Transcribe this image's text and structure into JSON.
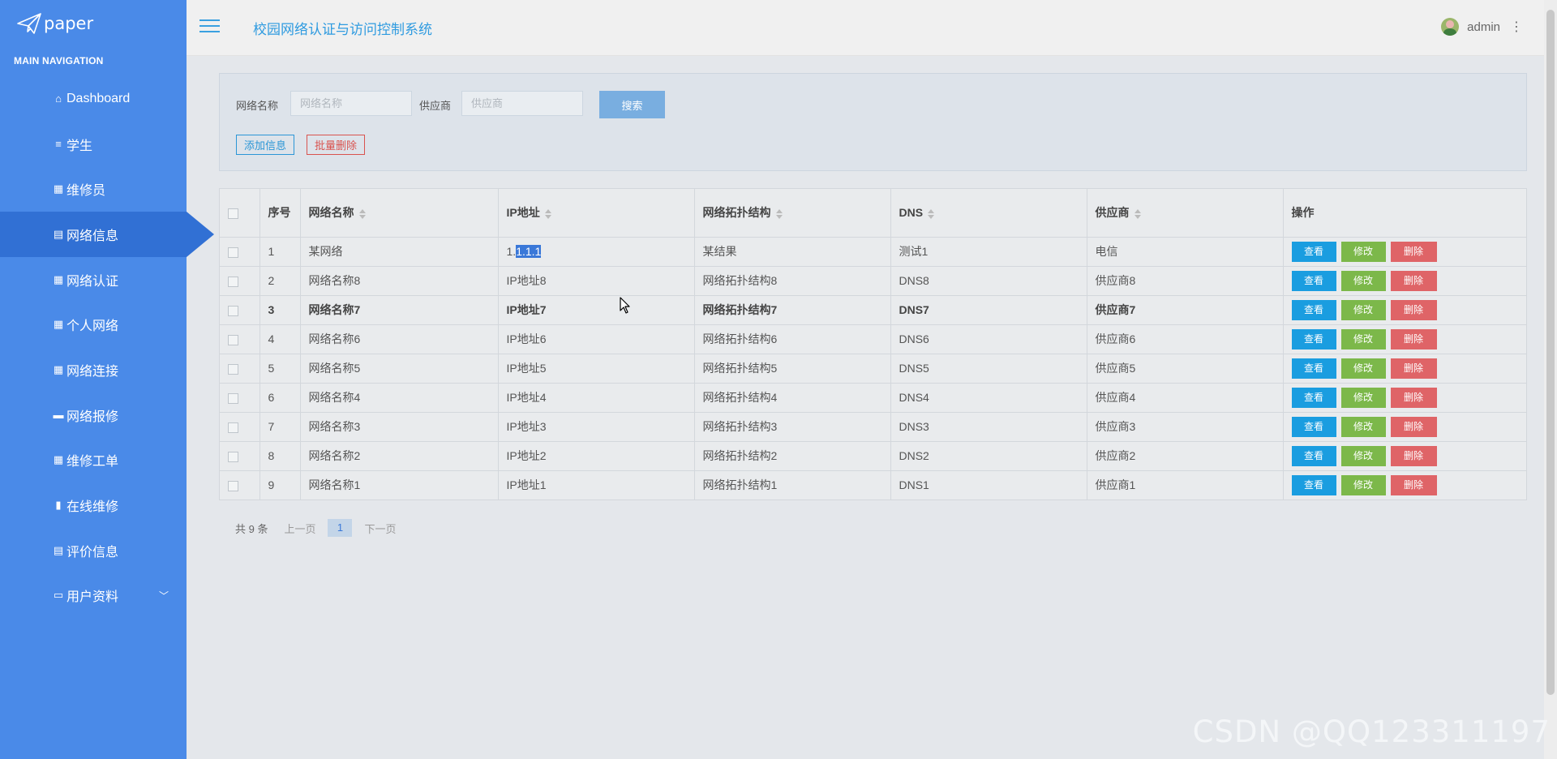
{
  "app": {
    "logo_text": "paper",
    "system_title": "校园网络认证与访问控制系统",
    "user_name": "admin"
  },
  "sidebar": {
    "header": "MAIN NAVIGATION",
    "items": [
      {
        "label": "Dashboard",
        "icon": "home-icon"
      },
      {
        "label": "学生",
        "icon": "list-icon"
      },
      {
        "label": "维修员",
        "icon": "grid-icon"
      },
      {
        "label": "网络信息",
        "icon": "clipboard-icon",
        "active": true
      },
      {
        "label": "网络认证",
        "icon": "grid-icon"
      },
      {
        "label": "个人网络",
        "icon": "grid-icon"
      },
      {
        "label": "网络连接",
        "icon": "grid-icon"
      },
      {
        "label": "网络报修",
        "icon": "briefcase-icon"
      },
      {
        "label": "维修工单",
        "icon": "grid-icon"
      },
      {
        "label": "在线维修",
        "icon": "book-icon"
      },
      {
        "label": "评价信息",
        "icon": "clipboard-icon"
      },
      {
        "label": "用户资料",
        "icon": "card-icon"
      }
    ]
  },
  "search": {
    "name_label": "网络名称",
    "name_placeholder": "网络名称",
    "vendor_label": "供应商",
    "vendor_placeholder": "供应商",
    "search_button": "搜索",
    "add_button": "添加信息",
    "batch_delete_button": "批量删除"
  },
  "table": {
    "headers": [
      "序号",
      "网络名称",
      "IP地址",
      "网络拓扑结构",
      "DNS",
      "供应商",
      "操作"
    ],
    "actions": {
      "view": "查看",
      "edit": "修改",
      "delete": "删除"
    },
    "rows": [
      {
        "no": "1",
        "name": "某网络",
        "ip_a": "1.",
        "ip_b": "1.1.1",
        "topo": "某结果",
        "dns": "测试1",
        "vendor": "电信"
      },
      {
        "no": "2",
        "name": "网络名称8",
        "ip_a": "IP地址8",
        "ip_b": "",
        "topo": "网络拓扑结构8",
        "dns": "DNS8",
        "vendor": "供应商8"
      },
      {
        "no": "3",
        "name": "网络名称7",
        "ip_a": "IP地址7",
        "ip_b": "",
        "topo": "网络拓扑结构7",
        "dns": "DNS7",
        "vendor": "供应商7",
        "bold": true
      },
      {
        "no": "4",
        "name": "网络名称6",
        "ip_a": "IP地址6",
        "ip_b": "",
        "topo": "网络拓扑结构6",
        "dns": "DNS6",
        "vendor": "供应商6"
      },
      {
        "no": "5",
        "name": "网络名称5",
        "ip_a": "IP地址5",
        "ip_b": "",
        "topo": "网络拓扑结构5",
        "dns": "DNS5",
        "vendor": "供应商5"
      },
      {
        "no": "6",
        "name": "网络名称4",
        "ip_a": "IP地址4",
        "ip_b": "",
        "topo": "网络拓扑结构4",
        "dns": "DNS4",
        "vendor": "供应商4"
      },
      {
        "no": "7",
        "name": "网络名称3",
        "ip_a": "IP地址3",
        "ip_b": "",
        "topo": "网络拓扑结构3",
        "dns": "DNS3",
        "vendor": "供应商3"
      },
      {
        "no": "8",
        "name": "网络名称2",
        "ip_a": "IP地址2",
        "ip_b": "",
        "topo": "网络拓扑结构2",
        "dns": "DNS2",
        "vendor": "供应商2"
      },
      {
        "no": "9",
        "name": "网络名称1",
        "ip_a": "IP地址1",
        "ip_b": "",
        "topo": "网络拓扑结构1",
        "dns": "DNS1",
        "vendor": "供应商1"
      }
    ]
  },
  "pagination": {
    "total": "共 9 条",
    "prev": "上一页",
    "current": "1",
    "next": "下一页"
  },
  "watermark": "CSDN @QQ123311197",
  "colors": {
    "sidebar": "#4a8ae8",
    "sidebar_active": "#3170d4",
    "view_button": "#1a9de0",
    "edit_button": "#7cb84a",
    "delete_button": "#df6467"
  }
}
